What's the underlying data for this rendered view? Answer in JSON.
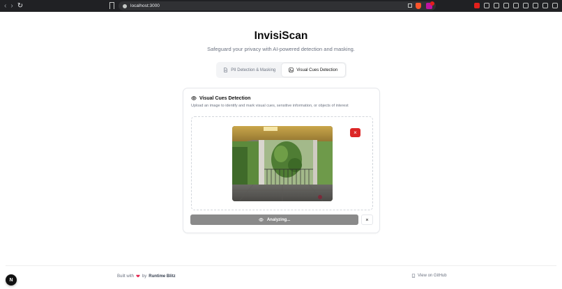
{
  "browser": {
    "url": "localhost:3000"
  },
  "header": {
    "title": "InvisiScan",
    "subtitle": "Safeguard your privacy with AI-powered detection and masking."
  },
  "tabs": [
    {
      "label": "PII Detection & Masking",
      "icon": "document-icon",
      "active": false
    },
    {
      "label": "Visual Cues Detection",
      "icon": "image-scan-icon",
      "active": true
    }
  ],
  "card": {
    "title": "Visual Cues Detection",
    "icon": "eye-icon",
    "description": "Upload an image to identify and mark visual cues, sensitive information, or objects of interest",
    "remove_label": "×",
    "analyze_label": "Analyzing...",
    "cancel_label": "×"
  },
  "footer": {
    "built_with": "Built with",
    "by": "by",
    "author": "Runtime Blitz",
    "github": "View on GitHub"
  },
  "badge": {
    "label": "N"
  },
  "colors": {
    "accent_red": "#dc2626",
    "button_gray": "#8a8a8a",
    "heart": "#e11d48"
  }
}
